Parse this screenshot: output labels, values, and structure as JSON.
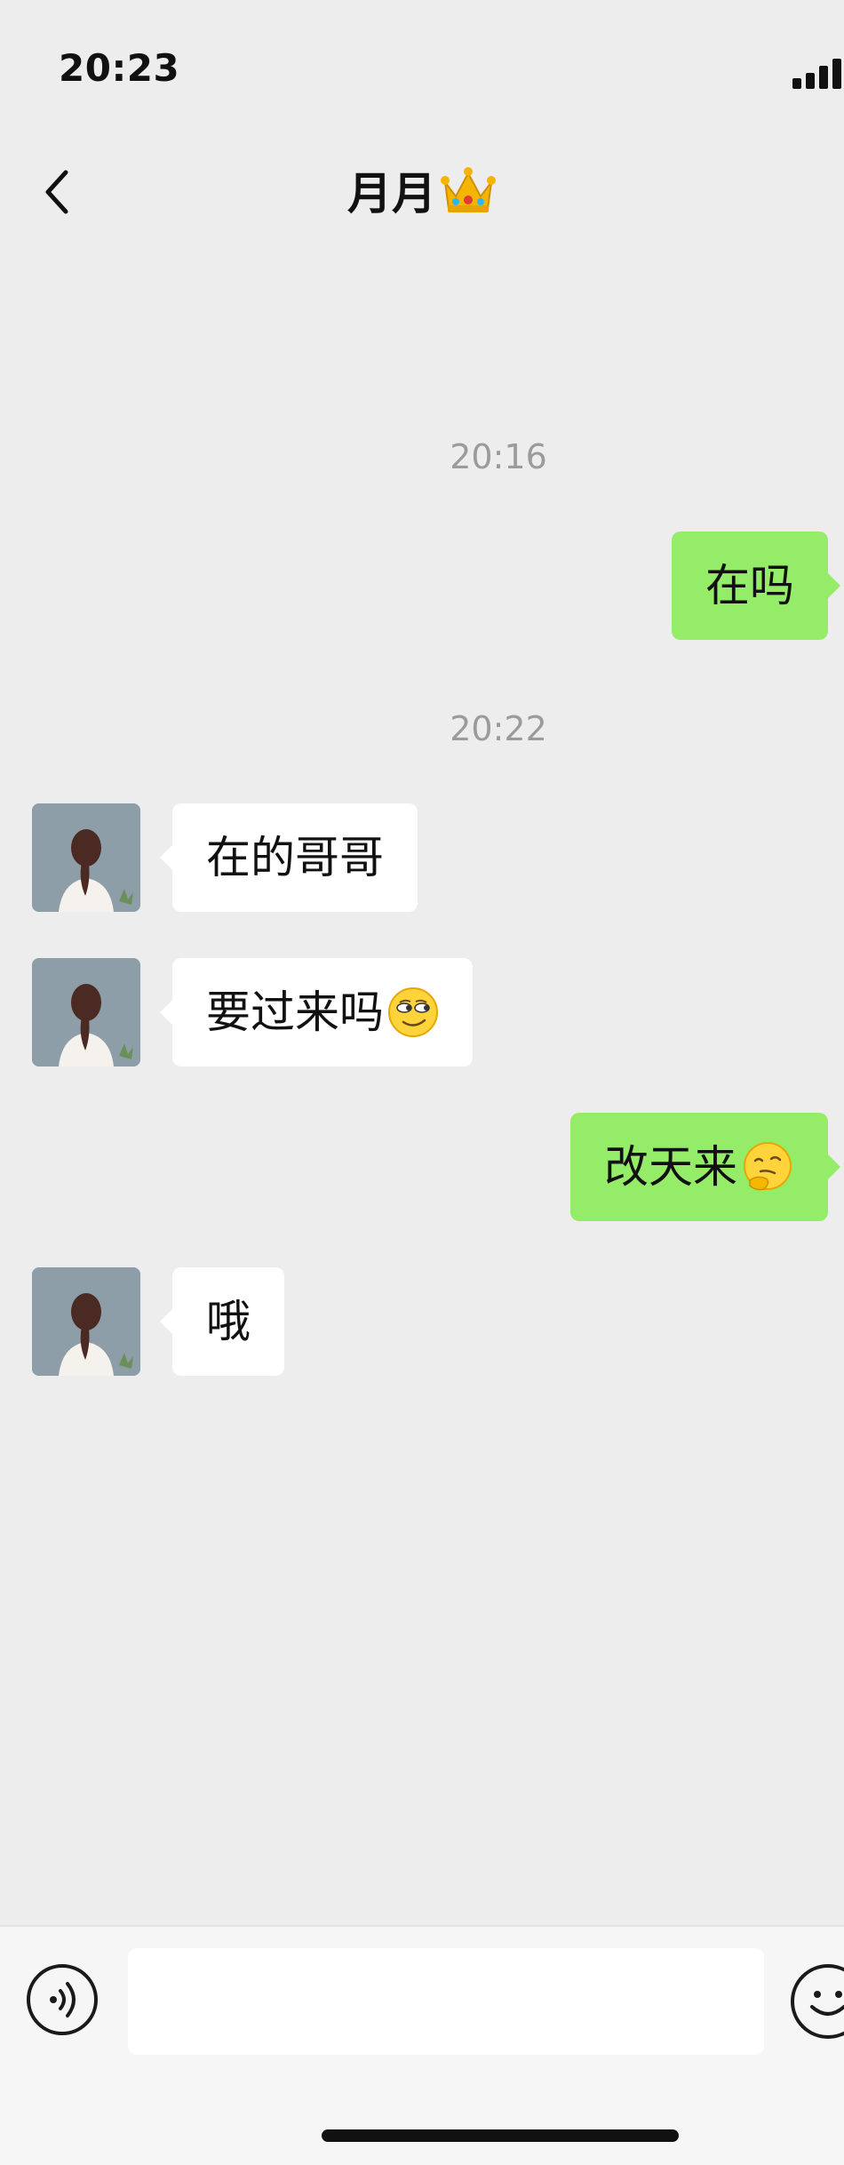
{
  "status_bar": {
    "time": "20:23"
  },
  "header": {
    "title": "月月",
    "title_icon": "crown-icon"
  },
  "messages": [
    {
      "type": "time",
      "text": "20:16"
    },
    {
      "type": "msg",
      "side": "out",
      "text": "在吗"
    },
    {
      "type": "time",
      "text": "20:22"
    },
    {
      "type": "msg",
      "side": "in",
      "text": "在的哥哥"
    },
    {
      "type": "msg",
      "side": "in",
      "text": "要过来吗",
      "emoji": "smirk-face-icon"
    },
    {
      "type": "msg",
      "side": "out",
      "text": "改天来",
      "emoji": "thinking-face-icon"
    },
    {
      "type": "msg",
      "side": "in",
      "text": "哦"
    }
  ],
  "input_bar": {
    "value": "",
    "left_icon": "voice-icon",
    "right_icon": "emoji-icon"
  },
  "colors": {
    "background": "#ededed",
    "outgoing_bubble": "#95ec69",
    "incoming_bubble": "#ffffff",
    "timestamp_text": "#9b9b9b"
  }
}
